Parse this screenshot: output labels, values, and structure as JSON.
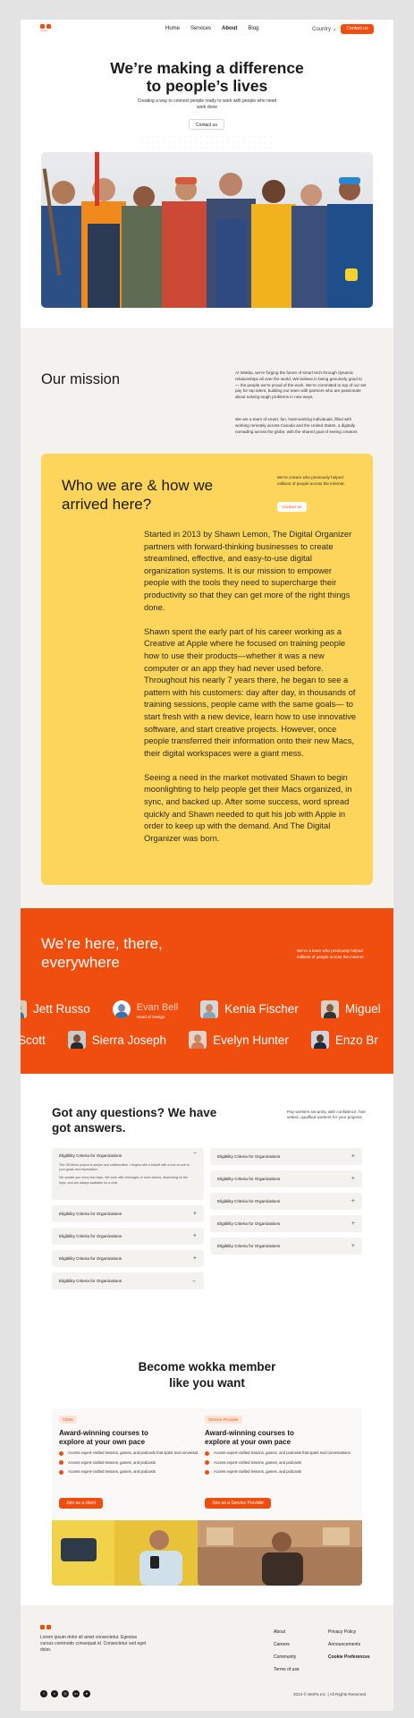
{
  "nav": {
    "logo_text": "wokka",
    "items": [
      "Home",
      "Services",
      "About",
      "Blog"
    ],
    "active": "About",
    "country_label": "Country",
    "contact_label": "Contact us"
  },
  "hero": {
    "title_line1": "We’re making a difference",
    "title_line2": "to people’s lives",
    "subtitle": "Creating a way to connect people ready to work with people who need work done",
    "contact_label": "Contact us"
  },
  "mission": {
    "title": "Our mission",
    "p1": "At Wokka, we’re forging the future of smart tech through dynamic relationships all over the world. We believe in being genuinely good to — the people we’re proud of the work. We’re committed to top of our set pay for top talent, building our team with partners who are passionate about solving tough problems in new ways.",
    "p2": "We are a team of smart, fun, hard-working individuals, filled with working remotely across Canada and the United States, a digitally nomading across the globe, with the shared goal of seeing creators thrive."
  },
  "who": {
    "title": "Who we are & how we arrived here?",
    "aside": "We’re a team who previously helped millions of people across the internet.",
    "aside_button": "Contact us",
    "paragraphs": [
      "Started in 2013 by Shawn Lemon, The Digital Organizer partners with forward-thinking businesses to create streamlined, effective, and easy-to-use digital organization systems. It is our mission to empower people with the tools they need to supercharge their productivity so that they can get more of the right things done.",
      "Shawn spent the early part of his career working as a Creative at Apple where he focused on training people how to use their products—whether it was a new computer or an app they had never used before. Throughout his nearly 7 years there, he began to see a pattern with his customers: day after day, in thousands of training sessions, people came with the same goals— to start fresh with a new device, learn how to use innovative software, and start creative projects. However, once people transferred their information onto their new Macs, their digital workspaces were a giant mess.",
      "Seeing a need in the market motivated Shawn to begin moonlighting to help people get their Macs organized, in sync, and backed up. After some success, word spread quickly and Shawn needed to quit his job with Apple in order to keep up with the demand. And The Digital Organizer was born."
    ]
  },
  "everywhere": {
    "title": "We’re here, there, everywhere",
    "aside": "We’re a team who previously helped millions of people across the internet.",
    "row1": [
      {
        "name": "Jett Russo"
      },
      {
        "name": "Evan Bell",
        "role": "Head of Design",
        "featured": true
      },
      {
        "name": "Kenia Fischer"
      },
      {
        "name": "Miguel"
      }
    ],
    "row2": [
      {
        "name": "Scott"
      },
      {
        "name": "Sierra Joseph"
      },
      {
        "name": "Evelyn Hunter"
      },
      {
        "name": "Enzo Br"
      }
    ]
  },
  "faq": {
    "title": "Got any questions? We have got answers.",
    "aside": "Pay workers securely, with confidence, hire vetted, qualified workers for your projects",
    "open_answer": [
      "The Off-Menu project is simple and collaborative. I begins with a kickoff with a one-to-one to your goals and expectation.",
      "We update you every few days. We work with messages or loom videos, depending on the topic, and are always available for a chat."
    ],
    "left": [
      {
        "q": "Eligibility Criteria for Organizations",
        "sign": "−",
        "open": true
      },
      {
        "q": "Eligibility Criteria for Organizations",
        "sign": "+"
      },
      {
        "q": "Eligibility Criteria for Organizations",
        "sign": "+"
      },
      {
        "q": "Eligibility Criteria for Organizations",
        "sign": "+"
      },
      {
        "q": "Eligibility Criteria for Organizations",
        "sign": "+"
      }
    ],
    "right": [
      {
        "q": "Eligibility Criteria for Organizations",
        "sign": "+"
      },
      {
        "q": "Eligibility Criteria for Organizations",
        "sign": "+"
      },
      {
        "q": "Eligibility Criteria for Organizations",
        "sign": "+"
      },
      {
        "q": "Eligibility Criteria for Organizations",
        "sign": "+"
      },
      {
        "q": "Eligibility Criteria for Organizations",
        "sign": "+"
      }
    ]
  },
  "member": {
    "title_line1": "Become wokka member",
    "title_line2": "like you want",
    "cards": [
      {
        "tag": "Client",
        "title": "Award-winning courses to explore at your own pace",
        "bullets": [
          "Access expert-crafted lessons, games, and podcasts that spark real conversations",
          "Access expert-crafted lessons, games, and podcasts",
          "Access expert-crafted lessons, games, and podcasts"
        ],
        "button": "Join as a client"
      },
      {
        "tag": "Service Provider",
        "title": "Award-winning courses to explore at your own pace",
        "bullets": [
          "Access expert-crafted lessons, games, and podcasts that spark real conversations",
          "Access expert-crafted lessons, games, and podcasts",
          "Access expert-crafted lessons, games, and podcasts"
        ],
        "button": "Join as a Service Provider"
      }
    ]
  },
  "footer": {
    "description": "Lorem ipsum dolor sit amet consectetur. Egestas cursus commodo consequat id. Consectetur sed eget dolor.",
    "col1": [
      "About",
      "Careers",
      "Community",
      "Terms of use"
    ],
    "col2": [
      "Privacy Policy",
      "Announcements",
      "Cookie Preferences"
    ],
    "social_icons": [
      "facebook-icon",
      "twitter-icon",
      "instagram-icon",
      "linkedin-icon",
      "telegram-icon"
    ],
    "copyright": "2024 © WoPa Inc. | All Rights Reserved"
  },
  "colors": {
    "accent": "#f04e0f",
    "yellow": "#fdd55a",
    "beige": "#f3f2ee"
  }
}
